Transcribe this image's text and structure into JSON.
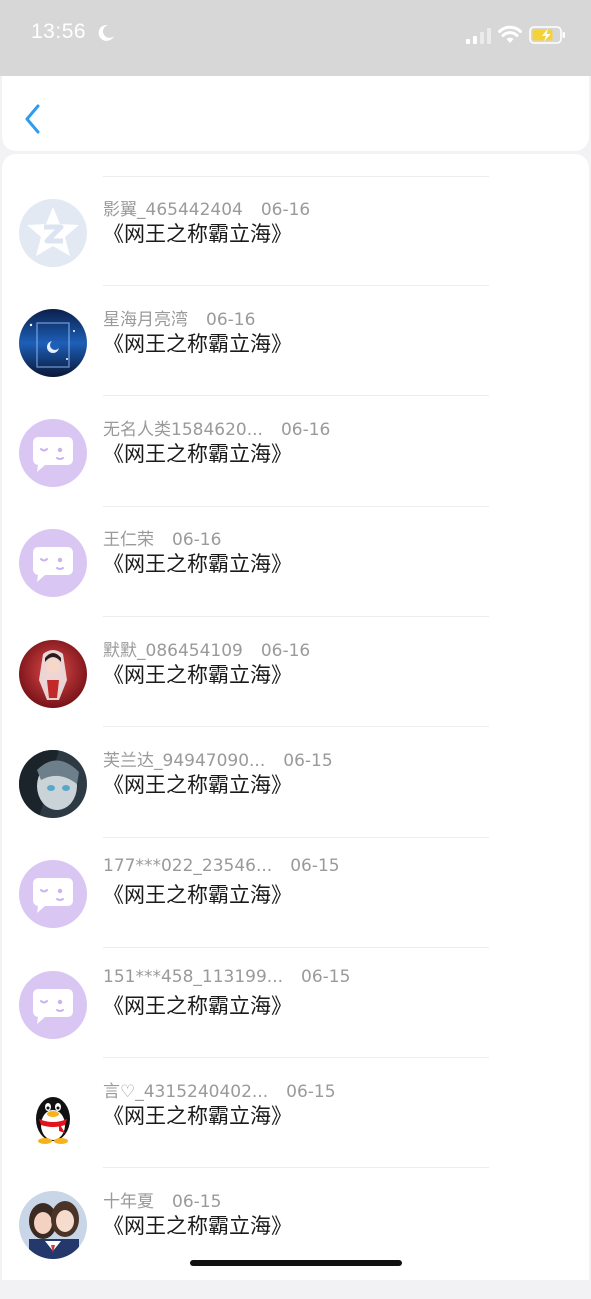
{
  "status_bar": {
    "time": "13:56"
  },
  "header": {
    "back_icon": "chevron-left-icon",
    "accent": "#2d9cf0"
  },
  "items": [
    {
      "name": "影翼_465442404",
      "date": "06-16",
      "title": "《网王之称霸立海》",
      "avatar": "qzone-default-avatar"
    },
    {
      "name": "星海月亮湾",
      "date": "06-16",
      "title": "《网王之称霸立海》",
      "avatar": "moon-night-avatar"
    },
    {
      "name": "无名人类1584620...",
      "date": "06-16",
      "title": "《网王之称霸立海》",
      "avatar": "chat-bubble-avatar"
    },
    {
      "name": "王仁荣",
      "date": "06-16",
      "title": "《网王之称霸立海》",
      "avatar": "chat-bubble-avatar"
    },
    {
      "name": "默默_086454109",
      "date": "06-16",
      "title": "《网王之称霸立海》",
      "avatar": "red-anime-avatar"
    },
    {
      "name": "芙兰达_94947090...",
      "date": "06-15",
      "title": "《网王之称霸立海》",
      "avatar": "anime-face-avatar"
    },
    {
      "name": "177***022_23546...",
      "date": "06-15",
      "title": "《网王之称霸立海》",
      "avatar": "chat-bubble-avatar"
    },
    {
      "name": "151***458_113199...",
      "date": "06-15",
      "title": "《网王之称霸立海》",
      "avatar": "chat-bubble-avatar"
    },
    {
      "name": "言♡_4315240402...",
      "date": "06-15",
      "title": "《网王之称霸立海》",
      "avatar": "qq-penguin-avatar"
    },
    {
      "name": "十年夏",
      "date": "06-15",
      "title": "《网王之称霸立海》",
      "avatar": "photo-avatar"
    }
  ]
}
